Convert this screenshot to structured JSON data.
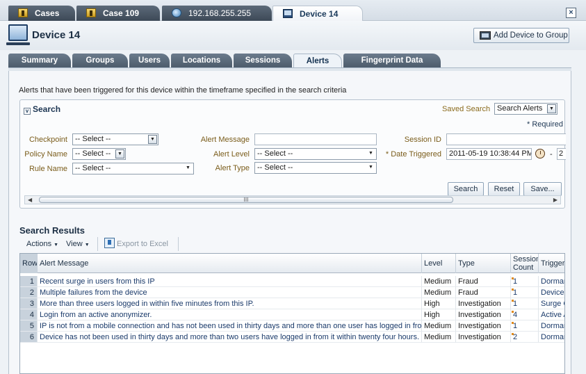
{
  "doc_tabs": [
    {
      "label": "Cases",
      "icon": "folder-icon"
    },
    {
      "label": "Case 109",
      "icon": "folder-icon"
    },
    {
      "label": "192.168.255.255",
      "icon": "globe-icon"
    },
    {
      "label": "Device 14",
      "icon": "monitor-icon"
    }
  ],
  "header": {
    "title": "Device 14",
    "add_group_label": "Add Device to Group"
  },
  "sub_tabs": [
    "Summary",
    "Groups",
    "Users",
    "Locations",
    "Sessions",
    "Alerts",
    "Fingerprint Data"
  ],
  "active_sub_tab": "Alerts",
  "description": "Alerts that have been triggered for this device within the timeframe specified in the search criteria",
  "search": {
    "title": "Search",
    "saved_search_label": "Saved Search",
    "saved_search_value": "Search Alerts",
    "required_note": "* Required",
    "checkpoint_label": "Checkpoint",
    "checkpoint_value": "-- Select --",
    "policy_label": "Policy Name",
    "policy_value": "-- Select --",
    "rule_label": "Rule Name",
    "rule_value": "-- Select --",
    "alert_message_label": "Alert Message",
    "alert_message_value": "",
    "alert_level_label": "Alert Level",
    "alert_level_value": "-- Select --",
    "alert_type_label": "Alert Type",
    "alert_type_value": "-- Select --",
    "session_id_label": "Session ID",
    "session_id_value": "",
    "date_label": "* Date Triggered",
    "date_from": "2011-05-19 10:38:44 PM",
    "date_to": "2",
    "date_sep": "-",
    "buttons": {
      "search": "Search",
      "reset": "Reset",
      "save": "Save..."
    }
  },
  "results": {
    "title": "Search Results",
    "actions_label": "Actions",
    "view_label": "View",
    "export_label": "Export to Excel",
    "columns": [
      "Row",
      "Alert Message",
      "Level",
      "Type",
      "Session Count",
      "Trigger"
    ],
    "rows": [
      {
        "row": "1",
        "message": "Recent surge in users from this IP",
        "level": "Medium",
        "type": "Fraud",
        "count": "1",
        "trigger": "Dormar"
      },
      {
        "row": "2",
        "message": "Multiple failures from the device",
        "level": "Medium",
        "type": "Fraud",
        "count": "1",
        "trigger": "Device"
      },
      {
        "row": "3",
        "message": "More than three users logged in within five minutes from this IP.",
        "level": "High",
        "type": "Investigation",
        "count": "1",
        "trigger": "Surge C"
      },
      {
        "row": "4",
        "message": "Login from an active anonymizer.",
        "level": "High",
        "type": "Investigation",
        "count": "4",
        "trigger": "Active A"
      },
      {
        "row": "5",
        "message": "IP is not from a mobile connection and has not been used in thirty days and more than one user has logged in from",
        "level": "Medium",
        "type": "Investigation",
        "count": "1",
        "trigger": "Dormar"
      },
      {
        "row": "6",
        "message": "Device has not been used in thirty days and more than two users have logged in from it within twenty four hours.",
        "level": "Medium",
        "type": "Investigation",
        "count": "2",
        "trigger": "Dormar"
      }
    ]
  }
}
